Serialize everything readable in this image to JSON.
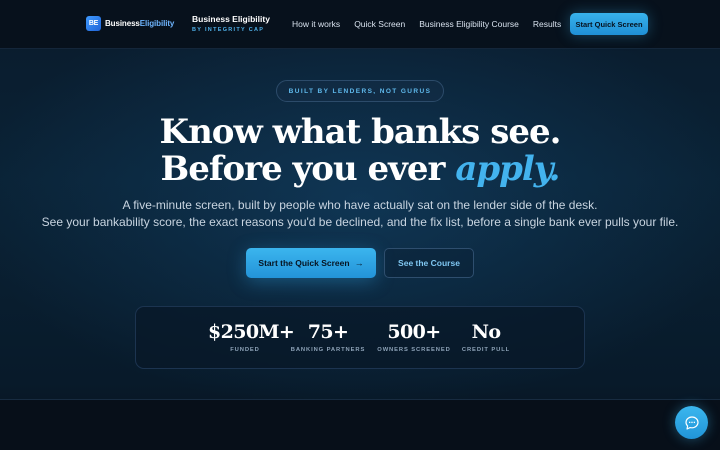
{
  "nav": {
    "logo_mark": "BE",
    "logo_word_1": "Business",
    "logo_word_2": "Eligibility",
    "brand_title": "Business Eligibility",
    "brand_subtitle": "BY INTEGRITY CAP",
    "links": [
      "How it works",
      "Quick Screen",
      "Business Eligibility Course",
      "Results"
    ],
    "cta_label": "Start Quick Screen"
  },
  "hero": {
    "badge": "BUILT BY LENDERS, NOT GURUS",
    "headline_line1": "Know what banks see.",
    "headline_line2_prefix": "Before you ever ",
    "headline_line2_accent": "apply.",
    "subtitle_line1": "A five-minute screen, built by people who have actually sat on the lender side of the desk.",
    "subtitle_line2": "See your bankability score, the exact reasons you'd be declined, and the fix list, before a single bank ever pulls your file.",
    "primary_cta": "Start the Quick Screen",
    "primary_cta_arrow": "→",
    "secondary_cta": "See the Course"
  },
  "stats": [
    {
      "value": "$250M+",
      "label": "FUNDED"
    },
    {
      "value": "75+",
      "label": "BANKING PARTNERS"
    },
    {
      "value": "500+",
      "label": "OWNERS SCREENED"
    },
    {
      "value": "No",
      "label": "CREDIT PULL"
    }
  ],
  "colors": {
    "accent": "#38b2ec",
    "accent_text": "#43b3ee",
    "background": "#071422"
  },
  "icons": {
    "chat": "chat-bubble-icon",
    "arrow": "arrow-right-icon"
  }
}
